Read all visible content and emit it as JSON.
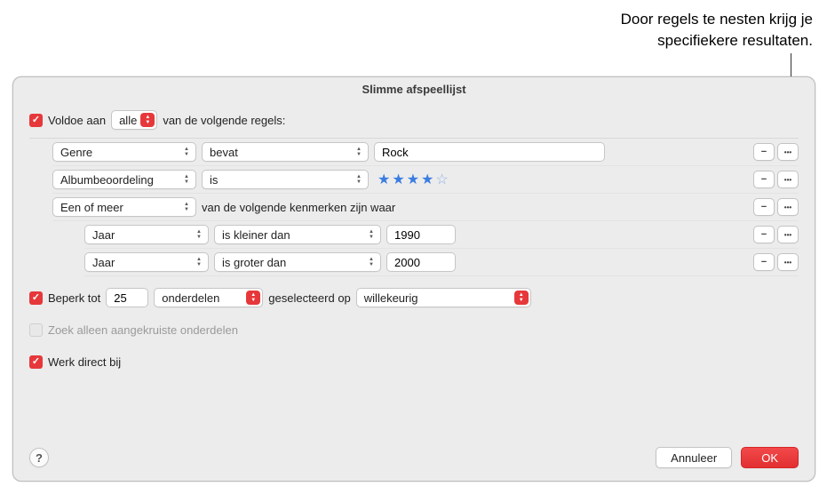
{
  "annotation": {
    "line1": "Door regels te nesten krijg je",
    "line2": "specifiekere resultaten."
  },
  "dialog": {
    "title": "Slimme afspeellijst",
    "match_prefix": "Voldoe aan",
    "match_select": "alle",
    "match_suffix": "van de volgende regels:",
    "rules": [
      {
        "field": "Genre",
        "op": "bevat",
        "value": "Rock",
        "type": "text"
      },
      {
        "field": "Albumbeoordeling",
        "op": "is",
        "type": "stars",
        "stars_filled": 4,
        "stars_total": 5
      },
      {
        "field": "Een of meer",
        "suffix": "van de volgende kenmerken zijn waar",
        "type": "group"
      },
      {
        "field": "Jaar",
        "op": "is kleiner dan",
        "value": "1990",
        "type": "num",
        "nested": true
      },
      {
        "field": "Jaar",
        "op": "is groter dan",
        "value": "2000",
        "type": "num",
        "nested": true
      }
    ],
    "limit": {
      "label": "Beperk tot",
      "value": "25",
      "unit": "onderdelen",
      "selected_by_label": "geselecteerd op",
      "selected_by_value": "willekeurig"
    },
    "only_checked": "Zoek alleen aangekruiste onderdelen",
    "live_update": "Werk direct bij",
    "buttons": {
      "cancel": "Annuleer",
      "ok": "OK",
      "help": "?"
    }
  }
}
